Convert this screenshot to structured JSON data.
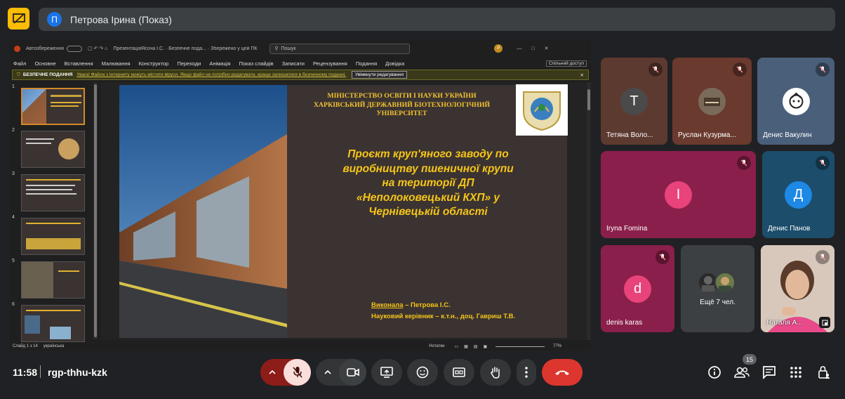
{
  "presenter": {
    "initial": "П",
    "label": "Петрова Ірина (Показ)"
  },
  "ppt": {
    "title_bar": {
      "autosave": "Автозбереження",
      "file_title": "ПрезентаціяЯсоча І.С. · Безпечне пода... · Збережено у цей ПК",
      "search": "Пошук",
      "user_initial": "P"
    },
    "menu": [
      "Файл",
      "Основне",
      "Вставлення",
      "Малювання",
      "Конструктор",
      "Переходи",
      "Анімація",
      "Показ слайдів",
      "Записати",
      "Рецензування",
      "Подання",
      "Довідка"
    ],
    "share": "Спільний доступ",
    "warning": {
      "label": "БЕЗПЕЧНЕ ПОДАННЯ",
      "text": "Увага! Файли з Інтернету можуть містити віруси. Якщо файл не потрібно редагувати, краще залишатися в безпечному поданні.",
      "button": "Увімкнути редагування"
    },
    "thumbnails": [
      "1",
      "2",
      "3",
      "4",
      "5",
      "6"
    ],
    "slide": {
      "ministry": [
        "МІНІСТЕРСТВО ОСВІТИ І НАУКИ УКРАЇНИ",
        "ХАРКІВСЬКИЙ ДЕРЖАВНИЙ БІОТЕХНОЛОГІЧНИЙ",
        "УНІВЕРСИТЕТ"
      ],
      "project_lines": [
        "Проєкт круп'яного заводу по",
        "виробництву пшеничної крупи",
        "на території ДП",
        "«Неполоковецький КХП» у",
        "Чернівецькій області"
      ],
      "author_label": "Виконала",
      "author_name": " – Петрова І.С.",
      "supervisor": "Науковий керівник – к.т.н., доц. Гавриш Т.В."
    },
    "status": {
      "slide": "Слайд 1 з 14",
      "lang": "українська",
      "notes": "Нотатки",
      "zoom": "77%"
    }
  },
  "participants": [
    {
      "initial": "Т",
      "name": "Тетяна Воло...",
      "bg": "#5d3a30",
      "avatar_bg": "#4a4a4a"
    },
    {
      "initial": "",
      "name": "Руслан Кузурма...",
      "bg": "#6a3a2e",
      "avatar_bg": "#7a6a5a"
    },
    {
      "initial": "",
      "name": "Денис Вакулин",
      "bg": "#4a5f7a",
      "avatar_bg": "#ffffff"
    },
    {
      "initial": "I",
      "name": "Iryna Fomina",
      "bg": "#8b1f4b",
      "avatar_bg": "#e8437a"
    },
    {
      "initial": "Д",
      "name": "Денис Панов",
      "bg": "#1c4d6b",
      "avatar_bg": "#1e88e5"
    },
    {
      "initial": "d",
      "name": "denis karas",
      "bg": "#8b1f4b",
      "avatar_bg": "#e8437a"
    },
    {
      "initial": "",
      "name": "Ещё 7 чел.",
      "bg": "#3c4043",
      "avatar_bg": "#3c4043"
    },
    {
      "initial": "",
      "name": "Наталя А...",
      "bg": "#c9b4a8",
      "avatar_bg": "#c9b4a8"
    }
  ],
  "bottom": {
    "time": "11:58",
    "meeting_code": "rgp-thhu-kzk",
    "people_count": "15"
  }
}
